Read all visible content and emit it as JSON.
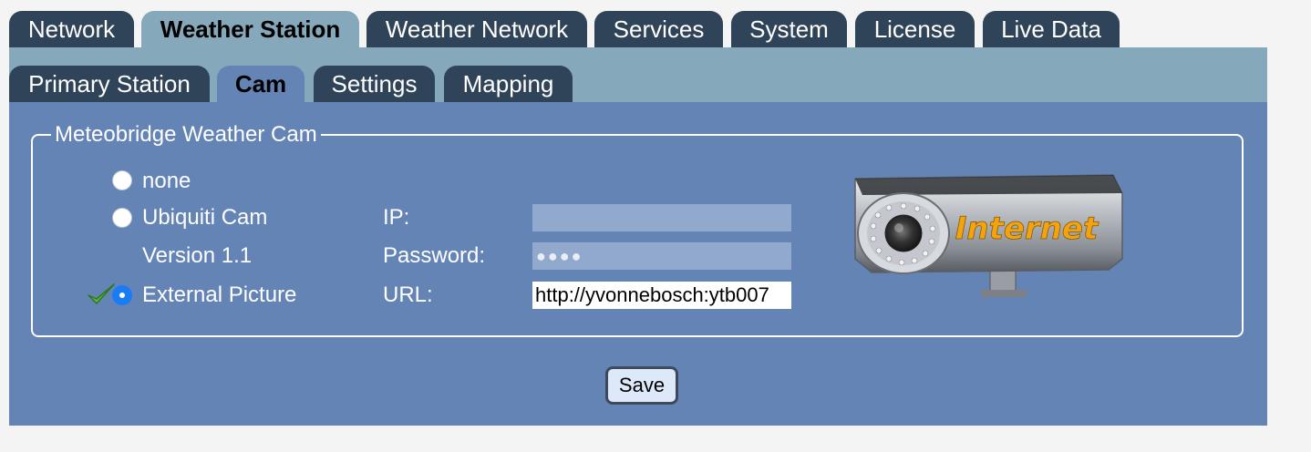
{
  "top_tabs": [
    {
      "label": "Network"
    },
    {
      "label": "Weather Station"
    },
    {
      "label": "Weather Network"
    },
    {
      "label": "Services"
    },
    {
      "label": "System"
    },
    {
      "label": "License"
    },
    {
      "label": "Live Data"
    }
  ],
  "active_top_tab": "Weather Station",
  "sub_tabs": [
    {
      "label": "Primary Station"
    },
    {
      "label": "Cam"
    },
    {
      "label": "Settings"
    },
    {
      "label": "Mapping"
    }
  ],
  "active_sub_tab": "Cam",
  "cam_section": {
    "legend": "Meteobridge Weather Cam",
    "options": {
      "none": "none",
      "ubiquiti": "Ubiquiti Cam",
      "version": "Version 1.1",
      "external": "External Picture"
    },
    "selected_option": "External Picture",
    "fields": {
      "ip_label": "IP:",
      "ip_value": "",
      "password_label": "Password:",
      "password_mask": "●●●●",
      "url_label": "URL:",
      "url_value": "http://yvonnebosch:ytb007"
    },
    "cam_image_text": "Internet"
  },
  "save_label": "Save",
  "colors": {
    "tab_bg": "#2f4359",
    "subpanel_bg": "#85a8ba",
    "main_bg": "#6484b5",
    "radio_selected": "#1a7cf5"
  }
}
